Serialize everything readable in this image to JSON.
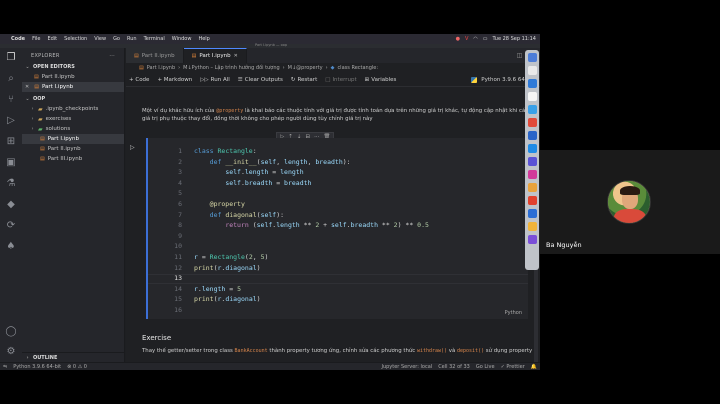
{
  "menubar": {
    "app": "Code",
    "items": [
      "File",
      "Edit",
      "Selection",
      "View",
      "Go",
      "Run",
      "Terminal",
      "Window",
      "Help"
    ],
    "clock": "Tue 28 Sep  11:14"
  },
  "window_title": "Part I.ipynb — oop",
  "sidebar": {
    "title": "EXPLORER",
    "open_editors_label": "OPEN EDITORS",
    "open_editors": [
      "Part II.ipynb",
      "Part I.ipynb"
    ],
    "folder_label": "OOP",
    "items": [
      {
        "label": ".ipynb_checkpoints",
        "type": "folder"
      },
      {
        "label": "exercises",
        "type": "folder"
      },
      {
        "label": "solutions",
        "type": "folder"
      },
      {
        "label": "Part I.ipynb",
        "type": "notebook"
      },
      {
        "label": "Part II.ipynb",
        "type": "notebook"
      },
      {
        "label": "Part III.ipynb",
        "type": "notebook"
      }
    ],
    "outline_label": "OUTLINE"
  },
  "tabs": [
    {
      "label": "Part II.ipynb"
    },
    {
      "label": "Part I.ipynb"
    }
  ],
  "breadcrumb": [
    "Part I.ipynb",
    "M↓Python – Lập trình hướng đối tượng",
    "M↓@property",
    "class Rectangle:"
  ],
  "toolbar": {
    "code": "+ Code",
    "markdown": "+ Markdown",
    "run_all": "Run All",
    "clear_outputs": "Clear Outputs",
    "restart": "Restart",
    "interrupt": "Interrupt",
    "variables": "Variables",
    "kernel": "Python 3.9.6 64-bit"
  },
  "markdown_intro": {
    "pre": "Một ví dụ khác hữu ích của ",
    "code": "@property",
    "post": " là khai báo các thuộc tính với giá trị được tính toán dựa trên những giá trị khác, tự động cập nhật khi các giá trị phụ thuộc thay đổi, đồng thời không cho phép người dùng tùy chỉnh giá trị này"
  },
  "code_cell": {
    "line_numbers": [
      "1",
      "2",
      "3",
      "4",
      "5",
      "6",
      "7",
      "8",
      "9",
      "10",
      "11",
      "12",
      "13",
      "14",
      "15",
      "16"
    ],
    "language": "Python"
  },
  "exercise": {
    "heading": "Exercise",
    "text_pre": "Thay thế getter/setter trong class ",
    "code1": "BankAccount",
    "text_mid": " thành property tương ứng, chỉnh sửa các phương thức ",
    "code2": "withdraw()",
    "text_and": " và ",
    "code3": "deposit()",
    "text_post": " sử dụng property"
  },
  "statusbar": {
    "python": "Python 3.9.6 64-bit",
    "errors": "⊗ 0  ⚠ 0",
    "jupyter": "Jupyter Server: local",
    "cell": "Cell 32 of 33",
    "golive": "Go Live",
    "prettier": "✓ Prettier"
  },
  "participant": {
    "name": "Ba Nguyễn"
  }
}
